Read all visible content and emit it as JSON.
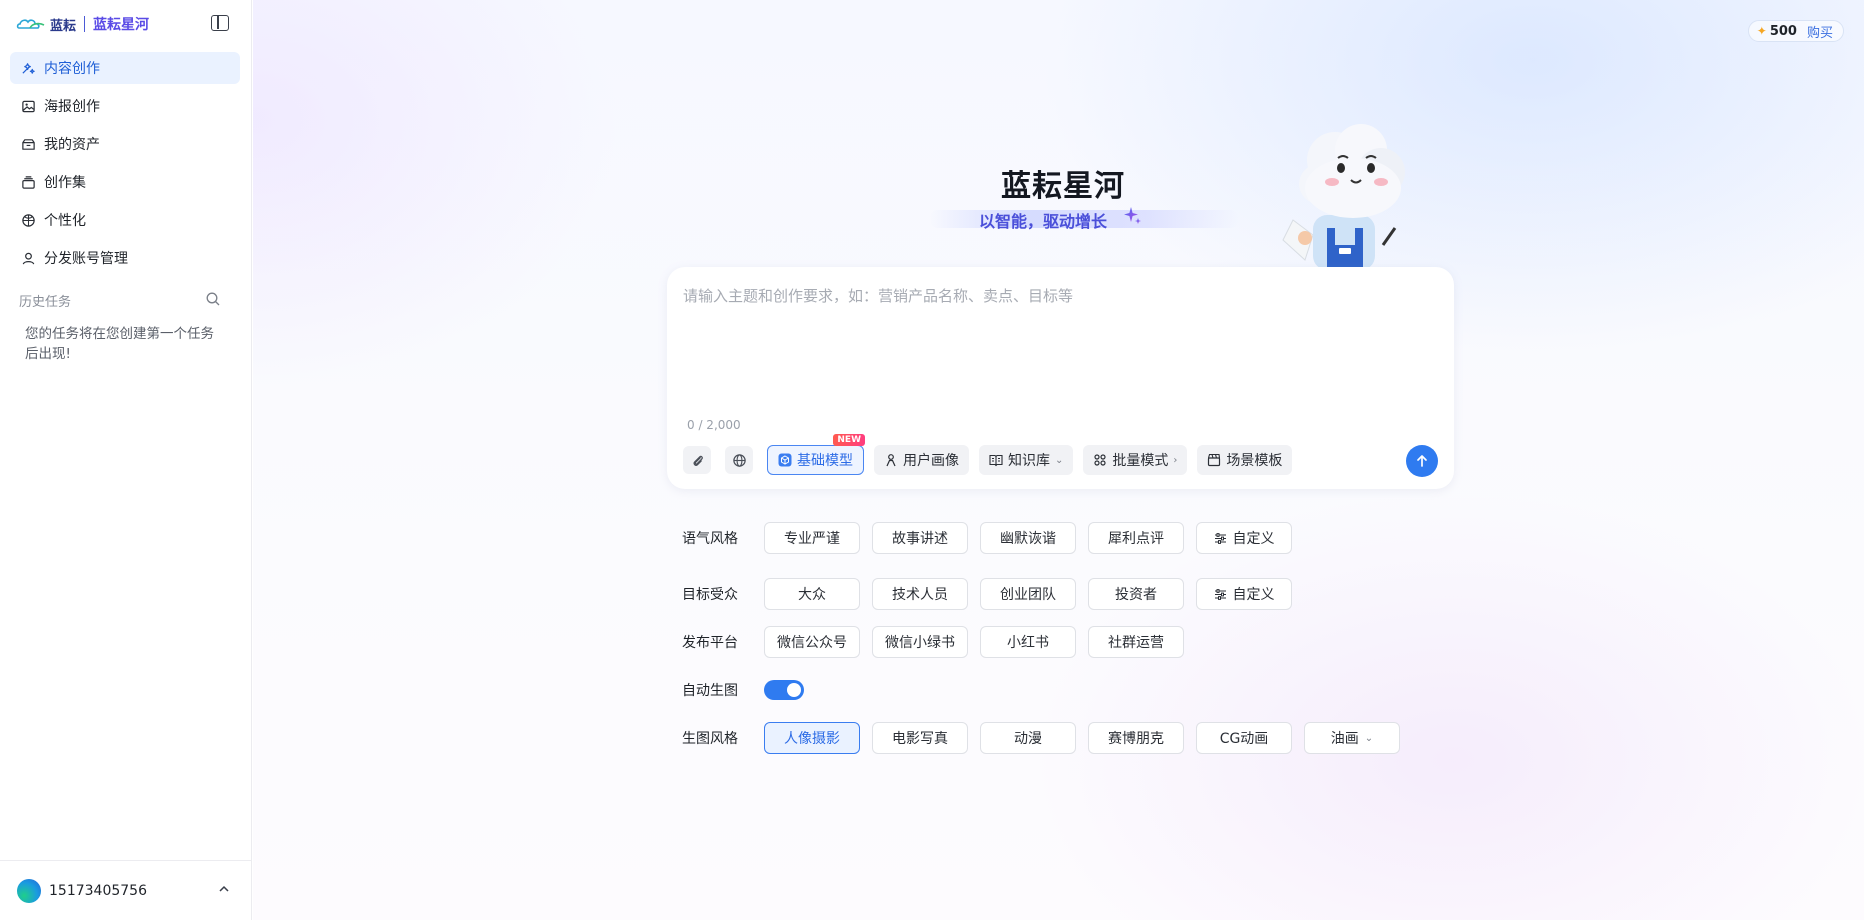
{
  "brand": {
    "logo_text": "蓝耘",
    "product_name": "蓝耘星河"
  },
  "sidebar": {
    "items": [
      {
        "label": "内容创作",
        "icon": "sparkle-edit-icon",
        "active": true
      },
      {
        "label": "海报创作",
        "icon": "image-icon",
        "active": false
      },
      {
        "label": "我的资产",
        "icon": "box-icon",
        "active": false
      },
      {
        "label": "创作集",
        "icon": "collection-icon",
        "active": false
      },
      {
        "label": "个性化",
        "icon": "palette-icon",
        "active": false
      },
      {
        "label": "分发账号管理",
        "icon": "user-icon",
        "active": false
      }
    ],
    "history_title": "历史任务",
    "history_empty": "您的任务将在您创建第一个任务后出现!"
  },
  "user": {
    "phone": "15173405756"
  },
  "credits": {
    "amount": "500",
    "buy_label": "购买"
  },
  "hero": {
    "title": "蓝耘星河",
    "subtitle": "以智能，驱动增长"
  },
  "composer": {
    "placeholder": "请输入主题和创作要求，如：营销产品名称、卖点、目标等",
    "value": "",
    "counter": "0 / 2,000",
    "tools": [
      {
        "label": "基础模型",
        "badge": "NEW",
        "active": true
      },
      {
        "label": "用户画像"
      },
      {
        "label": "知识库"
      },
      {
        "label": "批量模式"
      },
      {
        "label": "场景模板"
      }
    ]
  },
  "options": {
    "tone": {
      "label": "语气风格",
      "chips": [
        "专业严谨",
        "故事讲述",
        "幽默诙谐",
        "犀利点评",
        "自定义"
      ]
    },
    "audience": {
      "label": "目标受众",
      "chips": [
        "大众",
        "技术人员",
        "创业团队",
        "投资者",
        "自定义"
      ]
    },
    "platform": {
      "label": "发布平台",
      "chips": [
        "微信公众号",
        "微信小绿书",
        "小红书",
        "社群运营"
      ]
    },
    "auto_image": {
      "label": "自动生图",
      "enabled": true
    },
    "image_style": {
      "label": "生图风格",
      "chips": [
        "人像摄影",
        "电影写真",
        "动漫",
        "赛博朋克",
        "CG动画",
        "油画"
      ],
      "selected": "人像摄影"
    }
  },
  "colors": {
    "accent": "#2f7bf0",
    "brand_purple": "#4a4fd9",
    "active_bg": "#eaf2ff"
  }
}
